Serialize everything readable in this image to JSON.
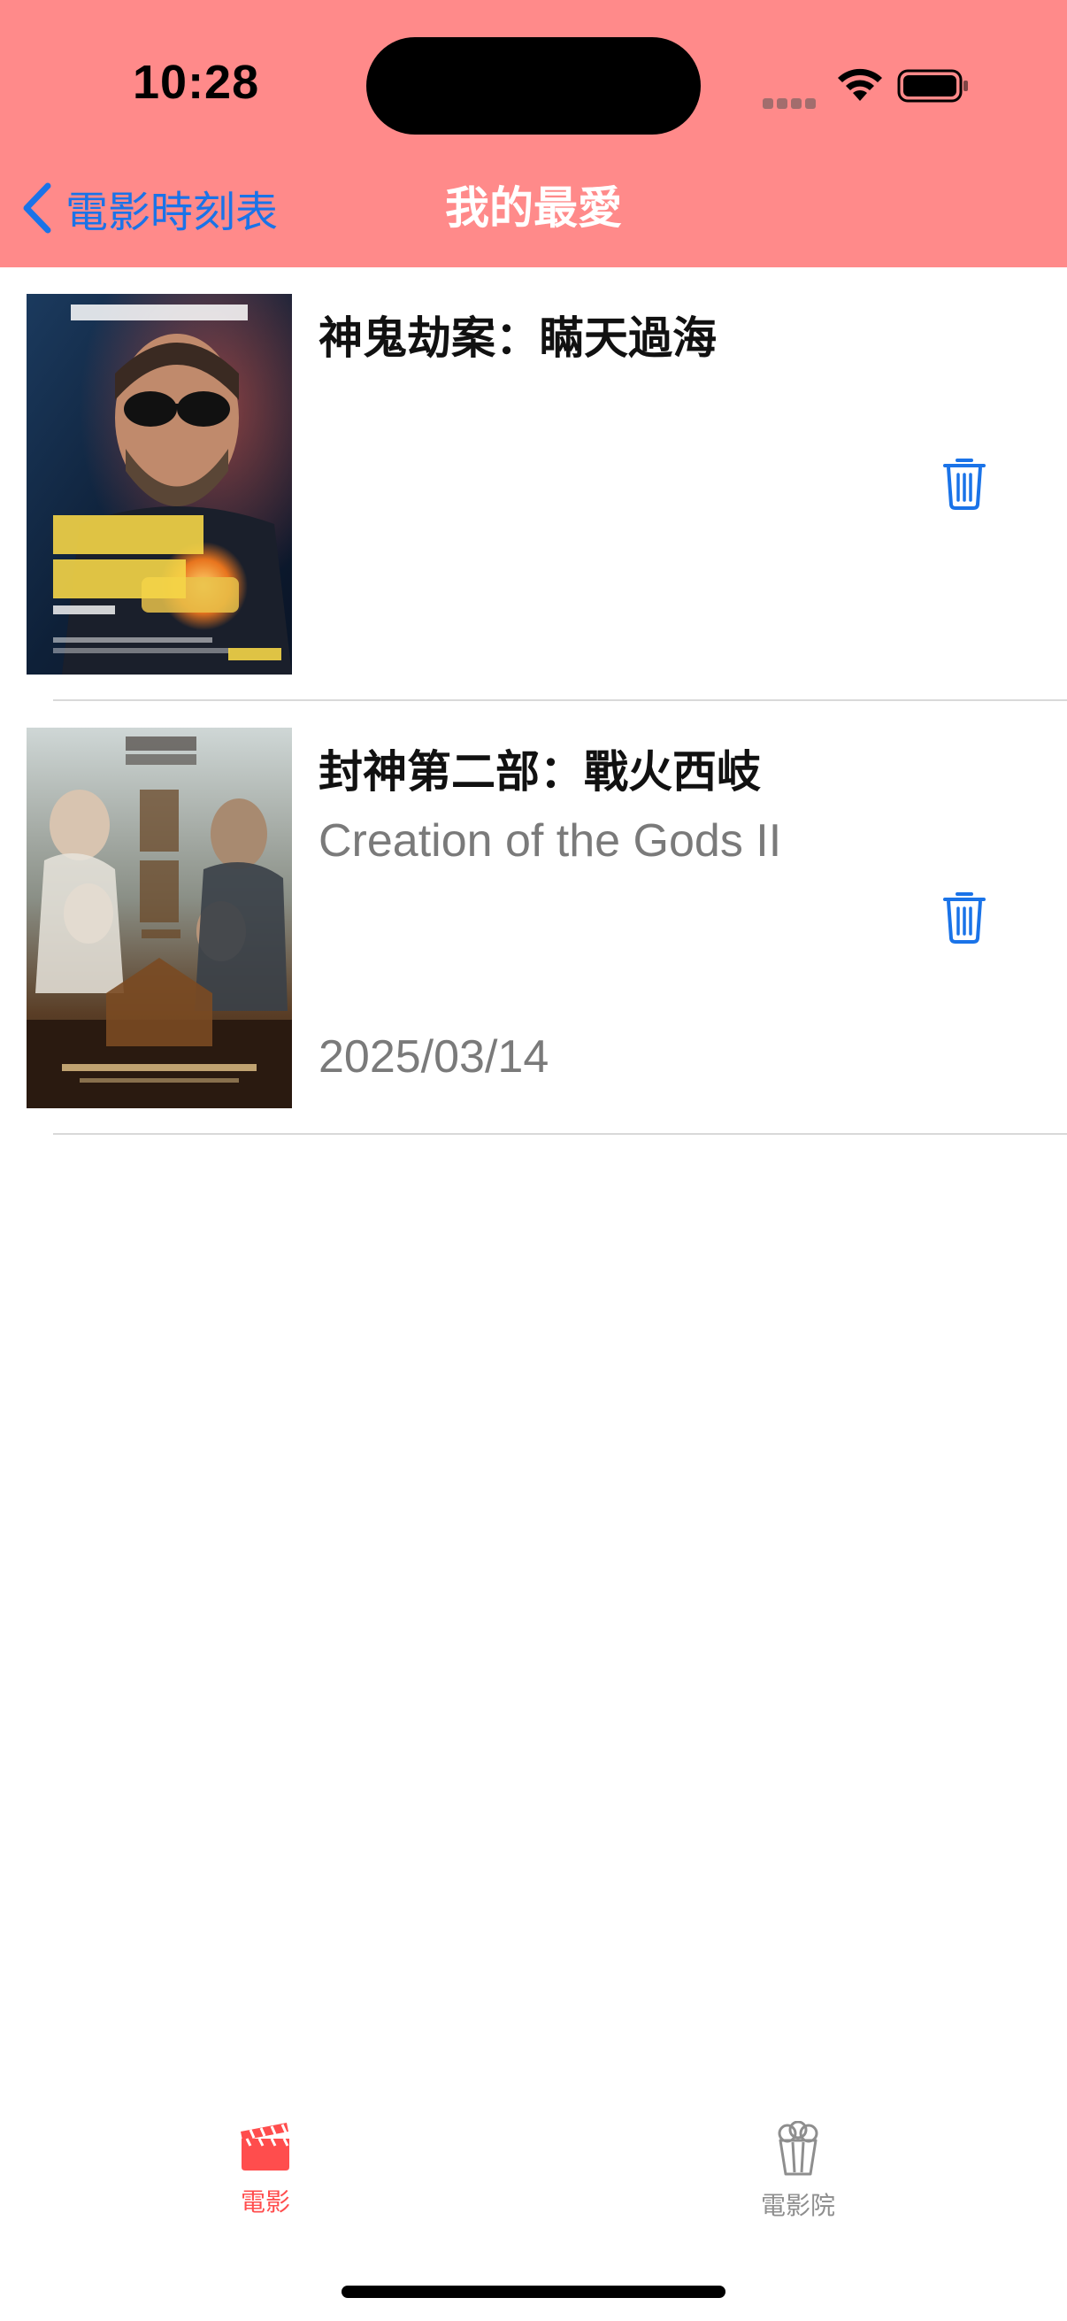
{
  "status_bar": {
    "time": "10:28"
  },
  "nav": {
    "back_label": "電影時刻表",
    "title": "我的最愛"
  },
  "favorites": [
    {
      "title": "神鬼劫案：瞞天過海",
      "subtitle": "",
      "date": "",
      "poster_texts": [
        "全球醫影帝 約翰屈伏塔",
        "神鬼劫案",
        "瞞天過海",
        "HIGH ROLLERS",
        "3.14 出獵人生"
      ]
    },
    {
      "title": "封神第二部：戰火西岐",
      "subtitle": "Creation of the Gods II",
      "date": "2025/03/14",
      "poster_texts": [
        "二〇二五",
        "封",
        "神",
        "第二部"
      ]
    }
  ],
  "tabbar": {
    "tabs": [
      {
        "label": "電影",
        "icon": "clapperboard-icon",
        "active": true
      },
      {
        "label": "電影院",
        "icon": "popcorn-icon",
        "active": false
      }
    ]
  },
  "colors": {
    "header_bg": "#ff8a8a",
    "accent_blue": "#1a73e8",
    "active_tab": "#ff4d4d",
    "inactive_tab": "#8e8e8e"
  }
}
